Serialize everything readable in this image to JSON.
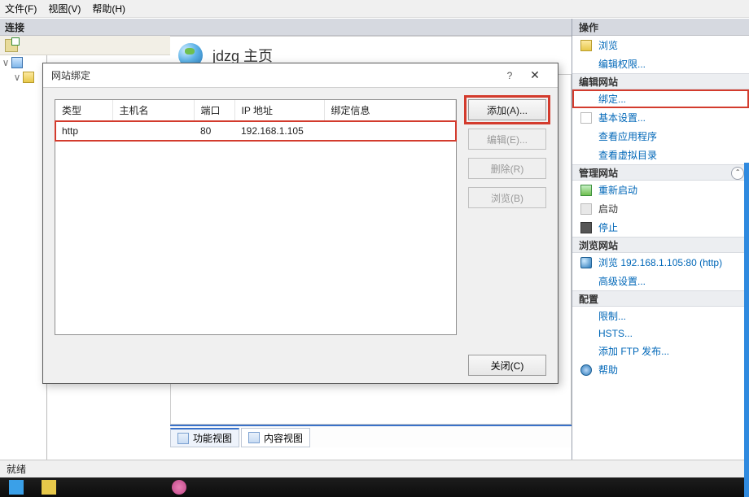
{
  "menu": {
    "file": "文件(F)",
    "view": "视图(V)",
    "help": "帮助(H)"
  },
  "connections_label": "连接",
  "page_title": "jdzg 主页",
  "tree": {
    "node_expander": "v"
  },
  "dialog": {
    "title": "网站绑定",
    "columns": {
      "type": "类型",
      "host": "主机名",
      "port": "端口",
      "ip": "IP 地址",
      "binding": "绑定信息"
    },
    "rows": [
      {
        "type": "http",
        "host": "",
        "port": "80",
        "ip": "192.168.1.105",
        "binding": ""
      }
    ],
    "buttons": {
      "add": "添加(A)...",
      "edit": "编辑(E)...",
      "delete": "删除(R)",
      "browse": "浏览(B)",
      "close": "关闭(C)"
    }
  },
  "actions": {
    "header": "操作",
    "explore": "浏览",
    "edit_perm": "编辑权限...",
    "section_edit_site": "编辑网站",
    "bindings": "绑定...",
    "basic_settings": "基本设置...",
    "view_apps": "查看应用程序",
    "view_vdirs": "查看虚拟目录",
    "section_manage_site": "管理网站",
    "restart": "重新启动",
    "start": "启动",
    "stop": "停止",
    "section_browse": "浏览网站",
    "browse_link": "浏览 192.168.1.105:80 (http)",
    "advanced": "高级设置...",
    "section_config": "配置",
    "limits": "限制...",
    "hsts": "HSTS...",
    "add_ftp": "添加 FTP 发布...",
    "help": "帮助"
  },
  "viewtabs": {
    "features": "功能视图",
    "content": "内容视图"
  },
  "status": "就绪"
}
